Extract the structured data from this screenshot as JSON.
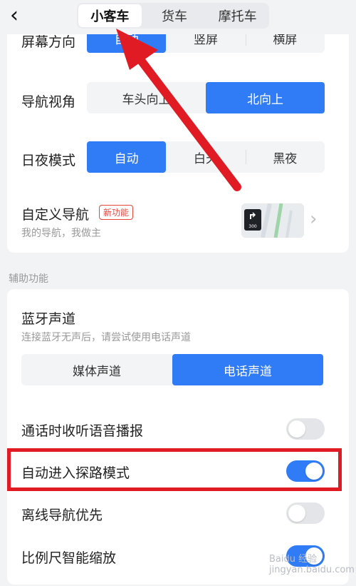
{
  "header": {
    "tabs": [
      {
        "label": "小客车",
        "active": true
      },
      {
        "label": "货车",
        "active": false
      },
      {
        "label": "摩托车",
        "active": false
      }
    ]
  },
  "nav_settings": {
    "screen_direction": {
      "label": "屏幕方向",
      "options": [
        "自动",
        "竖屏",
        "横屏"
      ],
      "selected": "自动"
    },
    "nav_view": {
      "label": "导航视角",
      "options": [
        "车头向上",
        "北向上"
      ],
      "selected": "北向上"
    },
    "day_night": {
      "label": "日夜模式",
      "options": [
        "自动",
        "白天",
        "黑夜"
      ],
      "selected": "自动"
    },
    "custom_nav": {
      "title": "自定义导航",
      "badge": "新功能",
      "subtitle": "我的导航，我做主"
    }
  },
  "assist": {
    "section_title": "辅助功能",
    "bluetooth": {
      "title": "蓝牙声道",
      "subtitle": "连接蓝牙无声后，请尝试使用电话声道",
      "options": [
        "媒体声道",
        "电话声道"
      ],
      "selected": "电话声道"
    },
    "toggles": [
      {
        "label": "通话时收听语音播报",
        "on": false
      },
      {
        "label": "自动进入探路模式",
        "on": true
      },
      {
        "label": "离线导航优先",
        "on": false
      },
      {
        "label": "比例尺智能缩放",
        "on": true
      }
    ]
  },
  "thumbnail_text": "300",
  "watermark": "Baidu 经验 jingyan.baidu.com",
  "colors": {
    "accent": "#2f7cf6",
    "annotation": "#e01b24"
  }
}
